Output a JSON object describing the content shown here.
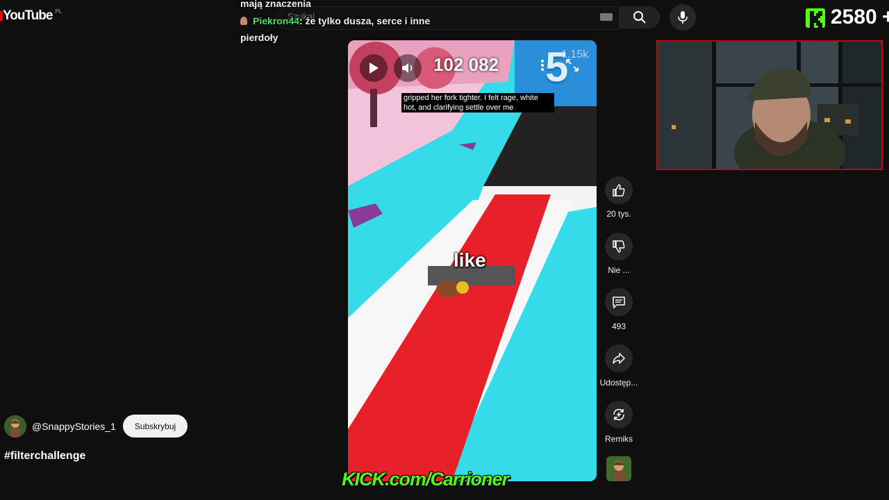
{
  "header": {
    "logo_text": "YouTube",
    "region": "PL",
    "search_placeholder": "Szukaj"
  },
  "chat": {
    "line1": "mają znaczenia",
    "user": "Piekron44",
    "message": ": że tylko dusza, serce i inne",
    "line3": "pierdoły"
  },
  "kick": {
    "count": "2580",
    "plus": "+",
    "banner": "KICK.com/Carrioner"
  },
  "video": {
    "score": "102 082",
    "level": "5",
    "coins": "1.15k",
    "subtitle": "gripped her fork tighter. I felt rage, white hot, and clarifying settle over me",
    "word_overlay": "like"
  },
  "actions": {
    "like": "20 tys.",
    "dislike": "Nie ...",
    "comments": "493",
    "share": "Udostęp...",
    "remix": "Remiks"
  },
  "channel": {
    "name": "@SnappyStories_1",
    "subscribe": "Subskrybuj",
    "hashtag": "#filterchallenge"
  },
  "colors": {
    "background": "#0f0f0f",
    "youtube_red": "#ff0000",
    "kick_green": "#53fc18",
    "chat_user": "#47e06a",
    "webcam_border": "#cc0000"
  },
  "icons": [
    "youtube-logo-icon",
    "keyboard-icon",
    "search-icon",
    "mic-icon",
    "kick-logo-icon",
    "play-icon",
    "volume-icon",
    "more-vert-icon",
    "expand-icon",
    "thumbs-up-icon",
    "thumbs-down-icon",
    "comment-icon",
    "share-icon",
    "remix-icon"
  ]
}
